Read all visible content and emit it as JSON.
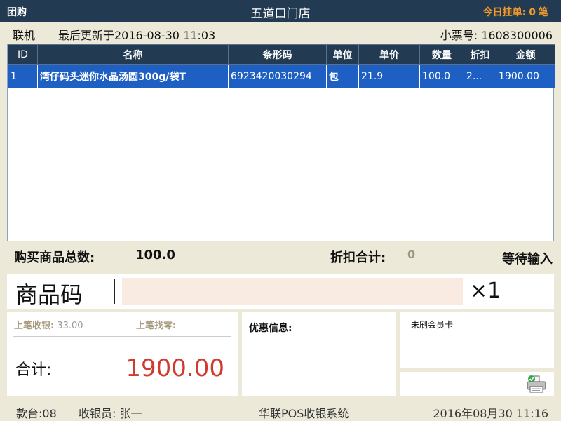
{
  "titlebar": {
    "left_label": "团购",
    "store_name": "五道口门店",
    "pending_label": "今日挂单:",
    "pending_count": "0",
    "pending_unit": "笔"
  },
  "infobar": {
    "status": "联机",
    "last_update": "最后更新于2016-08-30 11:03",
    "ticket_no": "小票号: 1608300006"
  },
  "table": {
    "headers": [
      "ID",
      "名称",
      "条形码",
      "单位",
      "单价",
      "数量",
      "折扣",
      "金额"
    ],
    "rows": [
      {
        "id": "1",
        "name": "湾仔码头迷你水晶汤圆300g/袋T",
        "barcode": "6923420030294",
        "unit": "包",
        "price": "21.9",
        "qty": "100.0",
        "discount": "2...",
        "amount": "1900.00"
      }
    ]
  },
  "summary": {
    "total_items_label": "购买商品总数:",
    "total_items_value": "100.0",
    "discount_label": "折扣合计:",
    "discount_value": "0",
    "status": "等待输入"
  },
  "code_entry": {
    "label": "商品码",
    "value": "",
    "multiplier": "×1"
  },
  "payment": {
    "prev_received_label": "上笔收银:",
    "prev_received_value": "33.00",
    "prev_change_label": "上笔找零:",
    "total_label": "合计:",
    "total_value": "1900.00"
  },
  "promo": {
    "label": "优惠信息:"
  },
  "member": {
    "label": "未刷会员卡"
  },
  "icons": {
    "printer": "printer-icon",
    "check": "check-icon"
  },
  "colors": {
    "titlebar_bg": "#233a53",
    "selected_row": "#1e5fc4",
    "total_red": "#d03b2f",
    "pending_orange": "#f39a2a",
    "input_bg": "#f9ebe1"
  },
  "footer": {
    "station": "款台:08",
    "cashier": "收银员: 张一",
    "system": "华联POS收银系统",
    "datetime": "2016年08月30  11:16"
  }
}
